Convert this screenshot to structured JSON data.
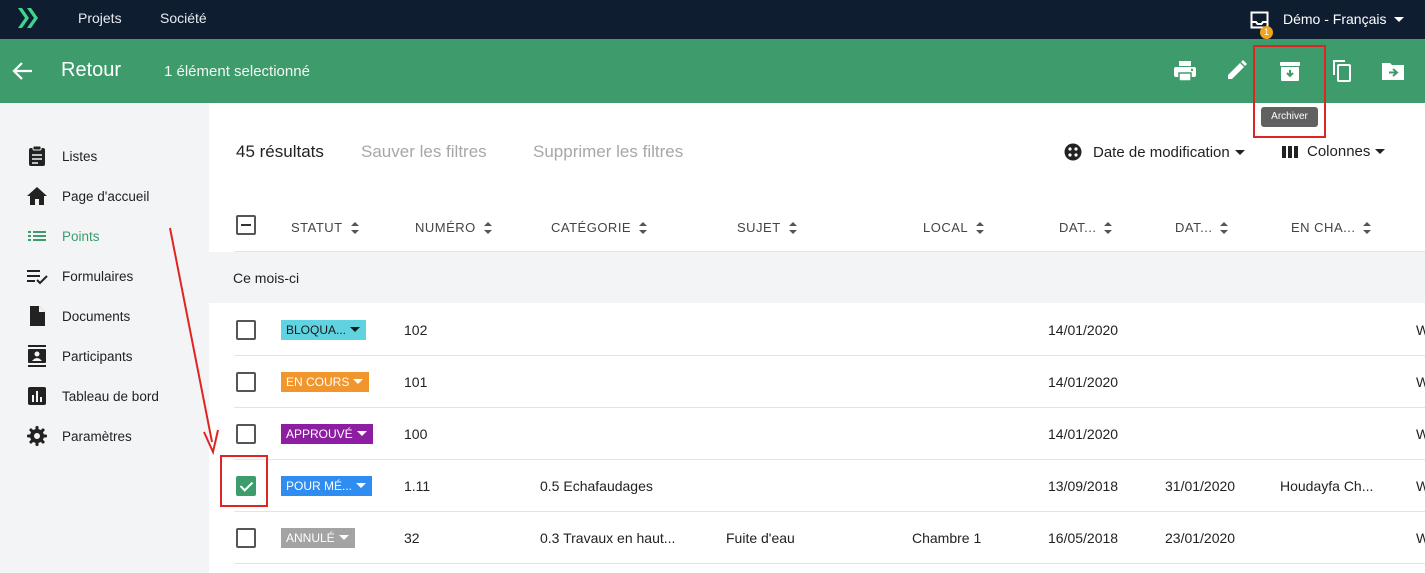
{
  "topbar": {
    "nav_items": [
      "Projets",
      "Société"
    ],
    "notification_count": "1",
    "user_label": "Démo - Français"
  },
  "actionbar": {
    "back_label": "Retour",
    "selection_text": "1 élément selectionné",
    "tooltip": "Archiver"
  },
  "sidebar": {
    "items": [
      {
        "label": "Listes",
        "icon": "clipboard-icon"
      },
      {
        "label": "Page d'accueil",
        "icon": "home-icon"
      },
      {
        "label": "Points",
        "icon": "list-icon",
        "active": true
      },
      {
        "label": "Formulaires",
        "icon": "checklist-icon"
      },
      {
        "label": "Documents",
        "icon": "document-icon"
      },
      {
        "label": "Participants",
        "icon": "contact-card-icon"
      },
      {
        "label": "Tableau de bord",
        "icon": "bar-chart-icon"
      },
      {
        "label": "Paramètres",
        "icon": "gear-icon"
      }
    ]
  },
  "toolbar": {
    "results": "45 résultats",
    "save_filters": "Sauver les filtres",
    "delete_filters": "Supprimer les filtres",
    "sort_label": "Date de modification",
    "columns_label": "Colonnes"
  },
  "table": {
    "headers": [
      "STATUT",
      "NUMÉRO",
      "CATÉGORIE",
      "SUJET",
      "LOCAL",
      "DAT...",
      "DAT...",
      "EN CHA..."
    ],
    "group": "Ce mois-ci",
    "rows": [
      {
        "checked": false,
        "status": "BLOQUA...",
        "status_bg": "#5fd3e0",
        "status_fg": "#1a1a1a",
        "numero": "102",
        "categorie": "",
        "sujet": "",
        "local": "",
        "date1": "14/01/2020",
        "date2": "",
        "encharge": "",
        "edge": "W"
      },
      {
        "checked": false,
        "status": "EN COURS",
        "status_bg": "#f0962d",
        "status_fg": "#ffffff",
        "numero": "101",
        "categorie": "",
        "sujet": "",
        "local": "",
        "date1": "14/01/2020",
        "date2": "",
        "encharge": "",
        "edge": "W"
      },
      {
        "checked": false,
        "status": "APPROUVÉ",
        "status_bg": "#8e1ea1",
        "status_fg": "#ffffff",
        "numero": "100",
        "categorie": "",
        "sujet": "",
        "local": "",
        "date1": "14/01/2020",
        "date2": "",
        "encharge": "",
        "edge": "W"
      },
      {
        "checked": true,
        "status": "POUR MÉ...",
        "status_bg": "#2f8cf0",
        "status_fg": "#ffffff",
        "numero": "1.11",
        "categorie": "0.5 Echafaudages",
        "sujet": "",
        "local": "",
        "date1": "13/09/2018",
        "date2": "31/01/2020",
        "encharge": "Houdayfa Ch...",
        "edge": "W"
      },
      {
        "checked": false,
        "status": "ANNULÉ",
        "status_bg": "#a3a3a3",
        "status_fg": "#ffffff",
        "numero": "32",
        "categorie": "0.3 Travaux en haut...",
        "sujet": "Fuite d'eau",
        "local": "Chambre 1",
        "date1": "16/05/2018",
        "date2": "23/01/2020",
        "encharge": "",
        "edge": "W"
      }
    ]
  },
  "colors": {
    "navbar": "#0f1d31",
    "primary_green": "#3e9c6c",
    "annotation_red": "#e02424"
  }
}
